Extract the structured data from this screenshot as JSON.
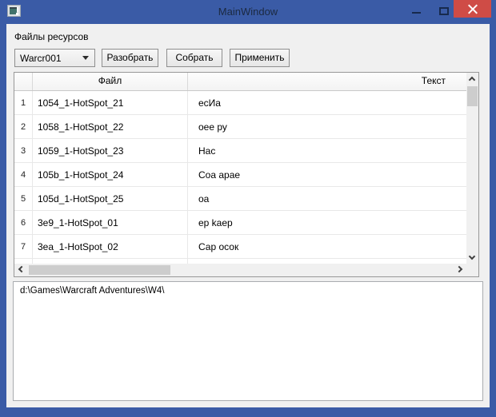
{
  "window": {
    "title": "MainWindow"
  },
  "icons": {
    "app-icon": "wpf-window-glyph",
    "minimize-icon": "–",
    "maximize-icon": "▢",
    "close-icon": "✕",
    "dropdown-arrow-icon": "▼",
    "scroll-up-icon": "∧",
    "scroll-down-icon": "∨",
    "scroll-left-icon": "‹",
    "scroll-right-icon": "›"
  },
  "colors": {
    "titlebar": "#3a5ba6",
    "close_button": "#cf4c46",
    "content_bg": "#f0f0f0",
    "scroll_thumb": "#cdcdcd"
  },
  "toolbar": {
    "files_label": "Файлы ресурсов",
    "resource_select": {
      "value": "Warcr001"
    },
    "parse_button": "Разобрать",
    "build_button": "Собрать",
    "apply_button": "Применить"
  },
  "table": {
    "columns": {
      "file": "Файл",
      "text": "Текст"
    },
    "rows": [
      {
        "num": "1",
        "file": "1054_1-HotSpot_21",
        "text": "есИа"
      },
      {
        "num": "2",
        "file": "1058_1-HotSpot_22",
        "text": "оее ру"
      },
      {
        "num": "3",
        "file": "1059_1-HotSpot_23",
        "text": "Нас"
      },
      {
        "num": "4",
        "file": "105b_1-HotSpot_24",
        "text": "Соа арае"
      },
      {
        "num": "5",
        "file": "105d_1-HotSpot_25",
        "text": "оа"
      },
      {
        "num": "6",
        "file": "3e9_1-HotSpot_01",
        "text": "ер kаер"
      },
      {
        "num": "7",
        "file": "3ea_1-HotSpot_02",
        "text": "Сар осок"
      }
    ]
  },
  "path_panel": {
    "text": "d:\\Games\\Warcraft Adventures\\W4\\"
  }
}
